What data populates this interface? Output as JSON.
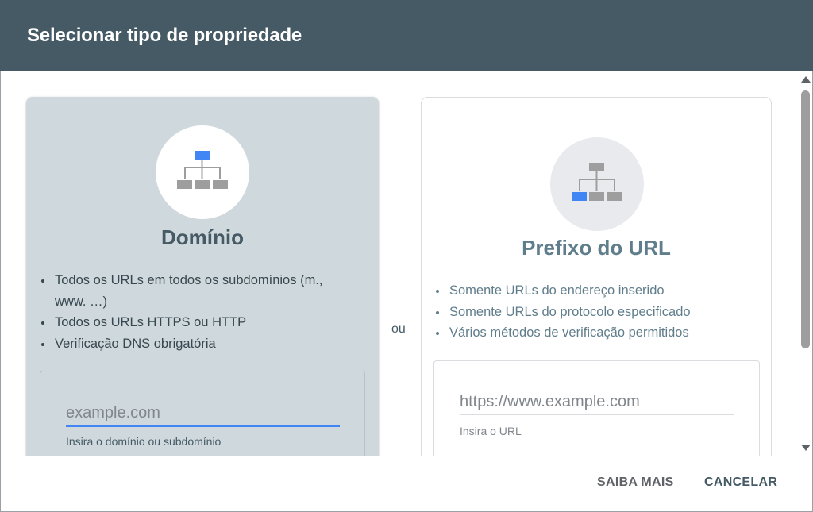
{
  "dialog": {
    "title": "Selecionar tipo de propriedade"
  },
  "domain_card": {
    "icon": "sitemap-root-icon",
    "title": "Domínio",
    "features": [
      "Todos os URLs em todos os subdomínios (m., www. …)",
      "Todos os URLs HTTPS ou HTTP",
      "Verificação DNS obrigatória"
    ],
    "input": {
      "value": "",
      "placeholder": "example.com",
      "helper": "Insira o domínio ou subdomínio"
    }
  },
  "separator": "ou",
  "prefix_card": {
    "icon": "sitemap-branch-icon",
    "title": "Prefixo do URL",
    "features": [
      "Somente URLs do endereço inserido",
      "Somente URLs do protocolo especificado",
      "Vários métodos de verificação permitidos"
    ],
    "input": {
      "value": "",
      "placeholder": "https://www.example.com",
      "helper": "Insira o URL"
    }
  },
  "footer": {
    "learn_more": "SAIBA MAIS",
    "cancel": "CANCELAR"
  },
  "colors": {
    "header_bg": "#455a64",
    "selected_card_bg": "#cfd8dc",
    "accent_blue": "#4285f4"
  }
}
